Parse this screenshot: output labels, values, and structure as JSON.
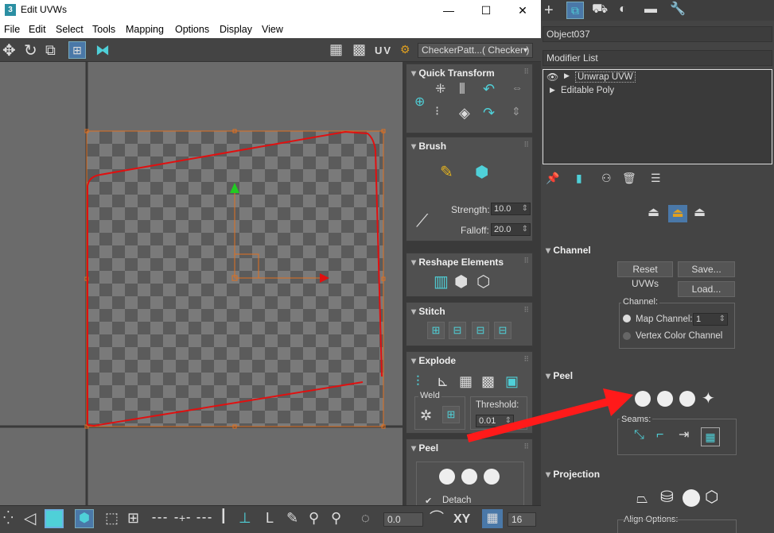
{
  "window": {
    "app_icon": "3",
    "title": "Edit UVWs",
    "controls": {
      "minimize": "—",
      "maximize": "☐",
      "close": "✕"
    }
  },
  "menu": [
    "File",
    "Edit",
    "Select",
    "Tools",
    "Mapping",
    "Options",
    "Display",
    "View"
  ],
  "toolbar": {
    "uv_label": "UV",
    "texture_dropdown": "CheckerPatt...( Checker )"
  },
  "rollouts": {
    "quick_transform": "Quick Transform",
    "brush": "Brush",
    "strength_label": "Strength:",
    "strength_value": "10.0",
    "falloff_label": "Falloff:",
    "falloff_value": "20.0",
    "reshape": "Reshape Elements",
    "stitch": "Stitch",
    "explode": "Explode",
    "weld": "Weld",
    "threshold_label": "Threshold:",
    "threshold_value": "0.01",
    "peel": "Peel",
    "detach": "Detach"
  },
  "bottom": {
    "angle_value": "0.0",
    "xy_label": "XY",
    "grid_value": "16"
  },
  "command_panel": {
    "object_name": "Object037",
    "modifier_list": "Modifier List",
    "stack": [
      "Unwrap UVW",
      "Editable Poly"
    ],
    "channel": {
      "title": "Channel",
      "reset": "Reset UVWs",
      "save": "Save...",
      "load": "Load...",
      "group": "Channel:",
      "map_channel": "Map Channel:",
      "map_channel_value": "1",
      "vertex_color": "Vertex Color Channel"
    },
    "peel": {
      "title": "Peel",
      "seams": "Seams:"
    },
    "projection": {
      "title": "Projection",
      "align": "Align Options:"
    }
  },
  "colors": {
    "uv_edge": "#e01010",
    "annotation_arrow": "#ff1a1a",
    "accent": "#4fd0d8"
  }
}
